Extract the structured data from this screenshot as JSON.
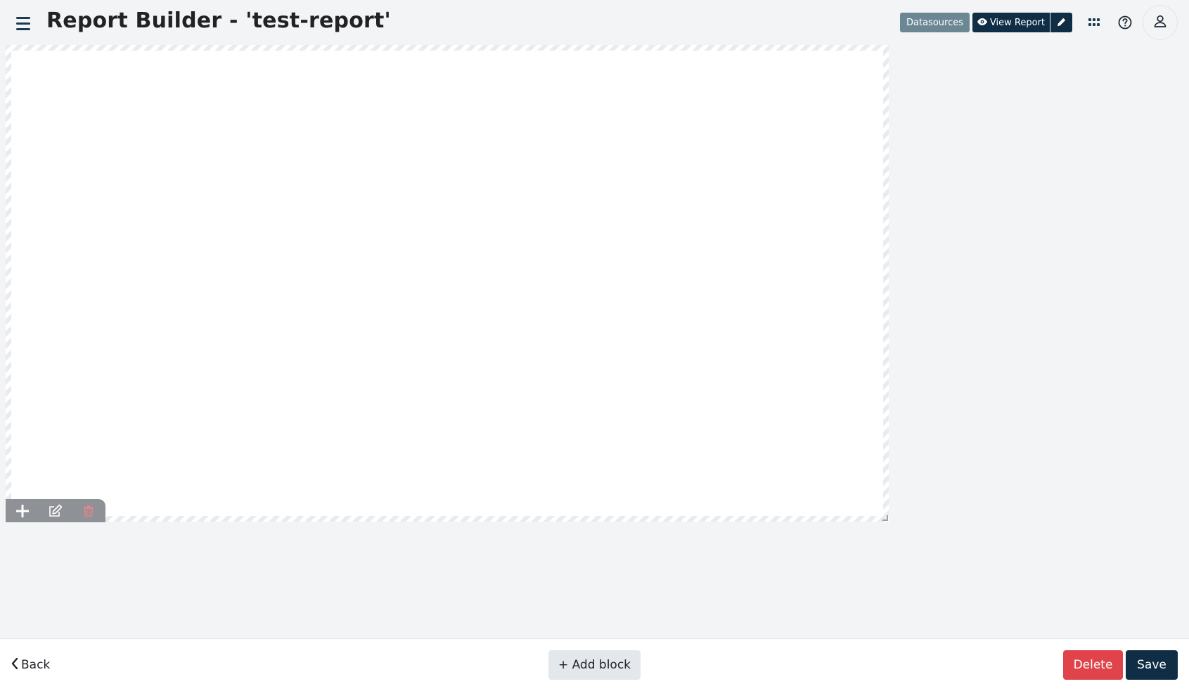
{
  "header": {
    "title": "Report Builder - 'test-report'",
    "datasources_label": "Datasources",
    "view_report_label": "View Report",
    "icons": {
      "menu": "hamburger-menu-icon",
      "view": "eye-icon",
      "edit": "pencil-icon",
      "apps": "grid-apps-icon",
      "help": "question-circle-icon",
      "user": "user-icon"
    }
  },
  "canvas": {
    "toolbar_icons": [
      "plus-icon",
      "edit-icon",
      "trash-icon"
    ]
  },
  "footer": {
    "back_label": "Back",
    "add_block_label": "+ Add block",
    "delete_label": "Delete",
    "save_label": "Save"
  },
  "colors": {
    "primary": "#0f2d44",
    "secondary": "#6b8794",
    "danger": "#e0434a",
    "background": "#f3f4f6"
  }
}
